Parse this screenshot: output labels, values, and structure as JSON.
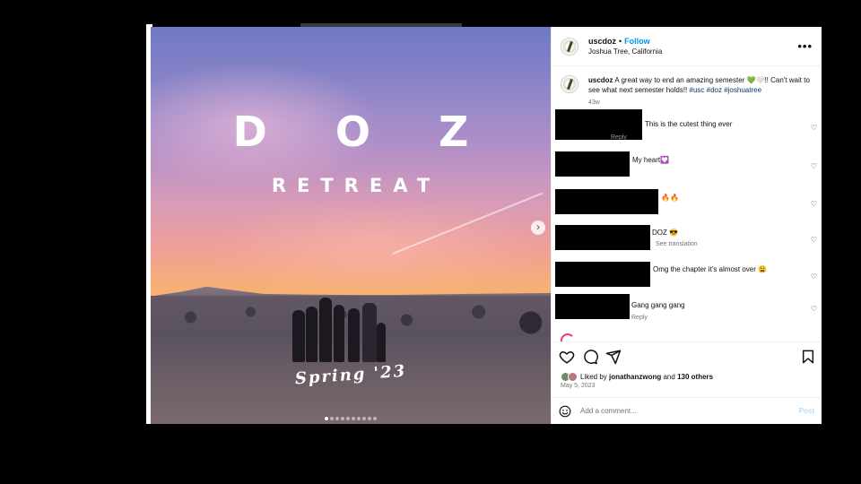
{
  "post": {
    "image": {
      "title": "D O Z",
      "subtitle": "RETREAT",
      "season": "Spring '23",
      "carousel_dots": 10,
      "active_dot": 1
    }
  },
  "header": {
    "username": "uscdoz",
    "separator": "•",
    "follow_label": "Follow",
    "location": "Joshua Tree, California",
    "more_icon": "more-horizontal-icon"
  },
  "caption": {
    "username": "uscdoz",
    "text": "A great way to end an amazing semester 💚🤍!! Can't wait to see what next semester holds!!",
    "hashtags": "#usc #doz #joshuatree",
    "age": "43w"
  },
  "comments": [
    {
      "text": "This is the cutest thing ever",
      "sub": "Reply"
    },
    {
      "text": "My heart💟",
      "sub": ""
    },
    {
      "text": "🔥🔥",
      "sub": ""
    },
    {
      "text": "DOZ 😎",
      "sub": "See translation"
    },
    {
      "text": "Omg the chapter it's almost over 😩",
      "sub": ""
    },
    {
      "text": "Gang gang gang",
      "sub": "Reply"
    }
  ],
  "likes": {
    "prefix": "Liked by",
    "user": "jonathanzwong",
    "joiner": "and",
    "others": "130 others",
    "date": "May 5, 2023"
  },
  "add_comment": {
    "placeholder": "Add a comment...",
    "post_label": "Post"
  },
  "colors": {
    "link_blue": "#0095f6",
    "hashtag_blue": "#00376b",
    "muted": "#737373"
  }
}
